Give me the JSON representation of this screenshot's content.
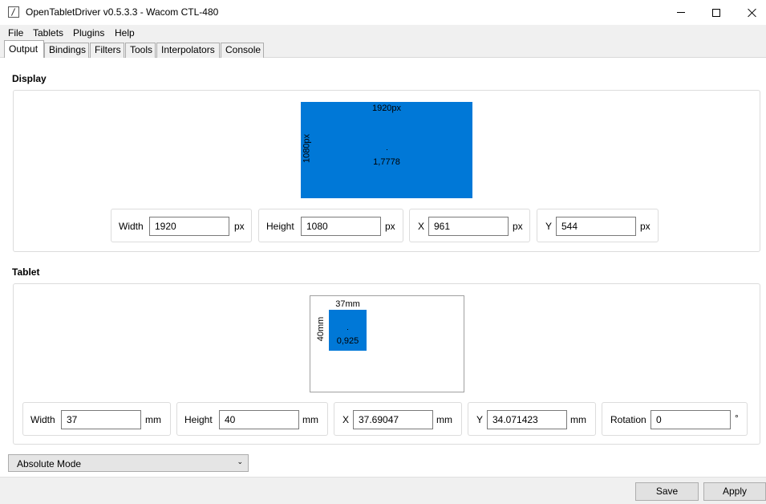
{
  "window": {
    "title": "OpenTabletDriver v0.5.3.3 - Wacom CTL-480"
  },
  "menu": {
    "items": [
      "File",
      "Tablets",
      "Plugins",
      "Help"
    ]
  },
  "tabs": [
    "Output",
    "Bindings",
    "Filters",
    "Tools",
    "Interpolators",
    "Console"
  ],
  "active_tab": "Output",
  "display": {
    "section_title": "Display",
    "area": {
      "width_label": "1920px",
      "height_label": "1080px",
      "ratio": "1,7778"
    },
    "fields": {
      "width": {
        "label": "Width",
        "value": "1920",
        "unit": "px"
      },
      "height": {
        "label": "Height",
        "value": "1080",
        "unit": "px"
      },
      "x": {
        "label": "X",
        "value": "961",
        "unit": "px"
      },
      "y": {
        "label": "Y",
        "value": "544",
        "unit": "px"
      }
    }
  },
  "tablet": {
    "section_title": "Tablet",
    "area": {
      "width_label": "37mm",
      "height_label": "40mm",
      "ratio": "0,925"
    },
    "fields": {
      "width": {
        "label": "Width",
        "value": "37",
        "unit": "mm"
      },
      "height": {
        "label": "Height",
        "value": "40",
        "unit": "mm"
      },
      "x": {
        "label": "X",
        "value": "37.69047",
        "unit": "mm"
      },
      "y": {
        "label": "Y",
        "value": "34.071423",
        "unit": "mm"
      },
      "rotation": {
        "label": "Rotation",
        "value": "0",
        "unit": "°"
      }
    }
  },
  "mode": {
    "selected": "Absolute Mode"
  },
  "footer": {
    "save": "Save",
    "apply": "Apply"
  },
  "colors": {
    "area": "#0078d7",
    "chrome": "#f0f0f0"
  }
}
